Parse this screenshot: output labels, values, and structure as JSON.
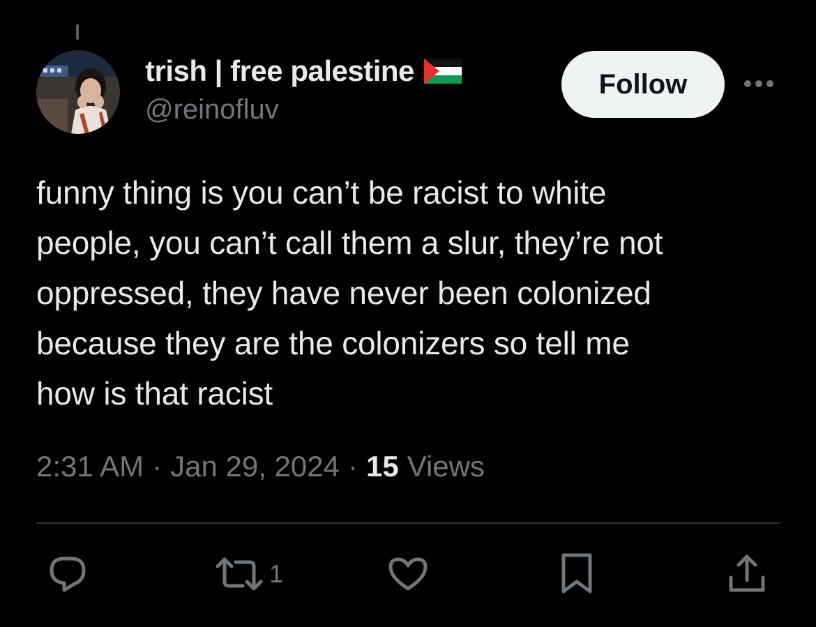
{
  "tweet": {
    "author": {
      "display_name": "trish | free palestine",
      "handle": "@reinofluv",
      "avatar_icon": "profile-avatar",
      "name_emoji_icon": "palestine-flag-icon"
    },
    "follow_label": "Follow",
    "more_icon": "more-dots-icon",
    "text": "funny thing is you can’t be racist to white\npeople, you can’t call them a slur, they’re not\noppressed, they have never been colonized\nbecause they are the colonizers so tell me\nhow is that racist",
    "time": "2:31 AM",
    "separator": "·",
    "date": "Jan 29, 2024",
    "views_count": "15",
    "views_label": "Views"
  },
  "actions": {
    "reply_icon": "reply-icon",
    "retweet_icon": "retweet-icon",
    "retweet_count": "1",
    "like_icon": "like-icon",
    "bookmark_icon": "bookmark-icon",
    "share_icon": "share-icon"
  },
  "colors": {
    "background": "#000000",
    "primary_text": "#e7e9ea",
    "secondary_text": "#71767b",
    "follow_button_bg": "#eff3f4",
    "divider": "#2f3336"
  }
}
